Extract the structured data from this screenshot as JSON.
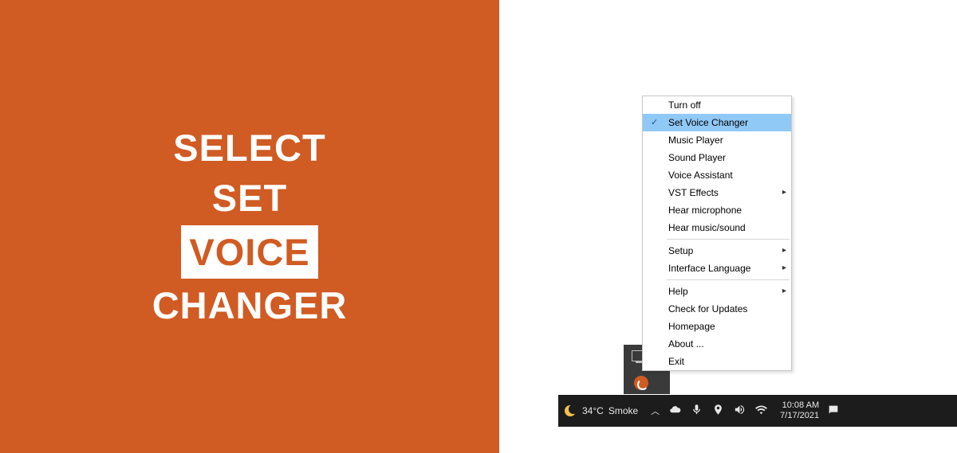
{
  "leftPanel": {
    "line1": "SELECT",
    "line2": "SET",
    "line3": "VOICE",
    "line4": "CHANGER"
  },
  "contextMenu": {
    "groups": [
      [
        {
          "label": "Turn off",
          "checked": false,
          "submenu": false,
          "selected": false
        },
        {
          "label": "Set Voice Changer",
          "checked": true,
          "submenu": false,
          "selected": true
        },
        {
          "label": "Music Player",
          "checked": false,
          "submenu": false,
          "selected": false
        },
        {
          "label": "Sound Player",
          "checked": false,
          "submenu": false,
          "selected": false
        },
        {
          "label": "Voice Assistant",
          "checked": false,
          "submenu": false,
          "selected": false
        },
        {
          "label": "VST Effects",
          "checked": false,
          "submenu": true,
          "selected": false
        },
        {
          "label": "Hear microphone",
          "checked": false,
          "submenu": false,
          "selected": false
        },
        {
          "label": "Hear music/sound",
          "checked": false,
          "submenu": false,
          "selected": false
        }
      ],
      [
        {
          "label": "Setup",
          "checked": false,
          "submenu": true,
          "selected": false
        },
        {
          "label": "Interface Language",
          "checked": false,
          "submenu": true,
          "selected": false
        }
      ],
      [
        {
          "label": "Help",
          "checked": false,
          "submenu": true,
          "selected": false
        },
        {
          "label": "Check for Updates",
          "checked": false,
          "submenu": false,
          "selected": false
        },
        {
          "label": "Homepage",
          "checked": false,
          "submenu": false,
          "selected": false
        },
        {
          "label": "About ...",
          "checked": false,
          "submenu": false,
          "selected": false
        },
        {
          "label": "Exit",
          "checked": false,
          "submenu": false,
          "selected": false
        }
      ]
    ]
  },
  "taskbar": {
    "temperature": "34°C",
    "condition": "Smoke",
    "time": "10:08 AM",
    "date": "7/17/2021"
  }
}
